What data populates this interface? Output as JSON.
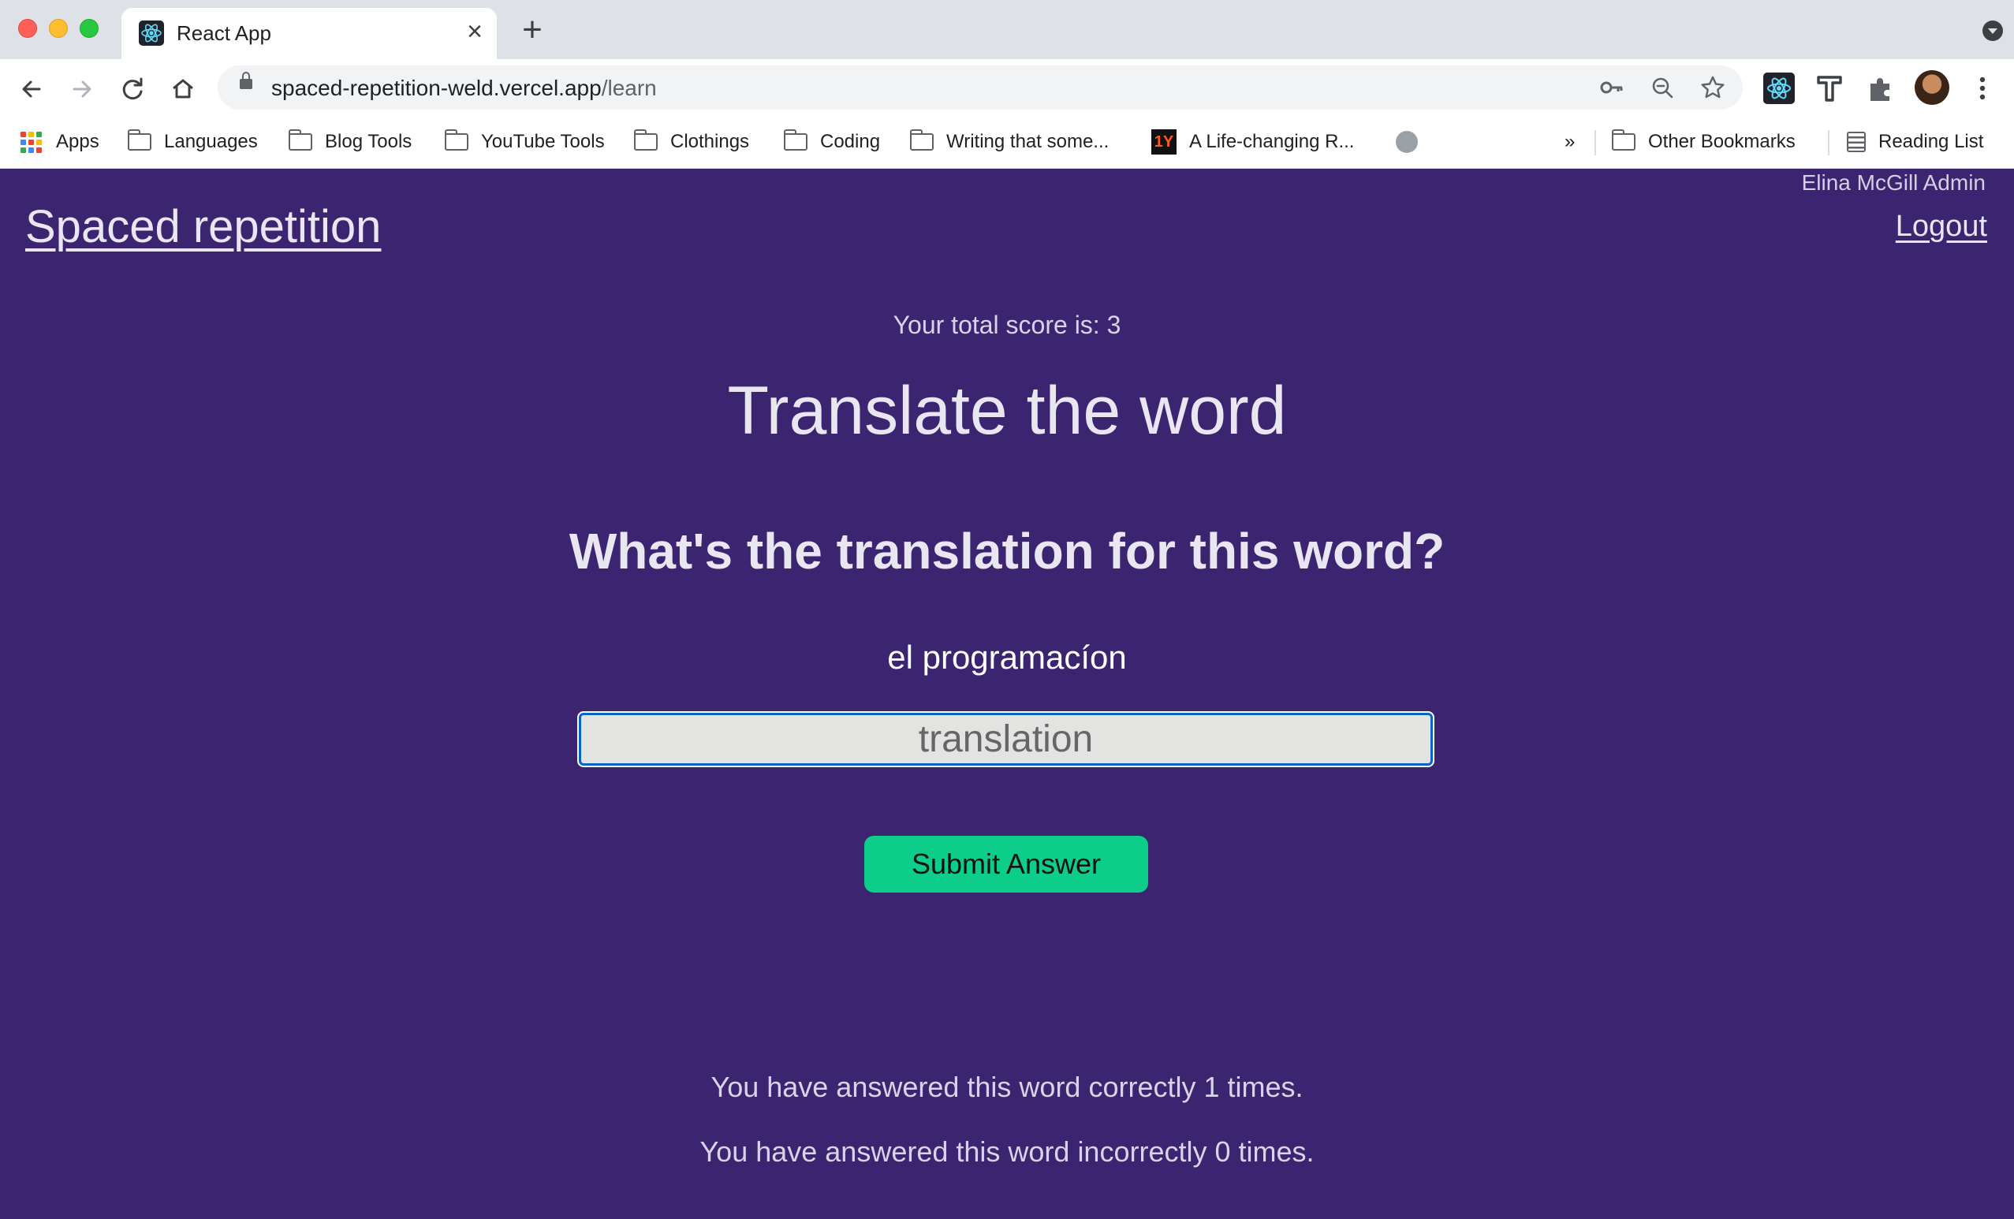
{
  "browser": {
    "tab_title": "React App",
    "url_host": "spaced-repetition-weld.vercel.app",
    "url_path": "/learn",
    "bookmarks": [
      "Apps",
      "Languages",
      "Blog Tools",
      "YouTube Tools",
      "Clothings",
      "Coding",
      "Writing that some...",
      "A Life-changing R..."
    ],
    "overflow_label": "»",
    "other_bookmarks": "Other Bookmarks",
    "reading_list": "Reading List"
  },
  "header": {
    "user_name": "Elina McGill Admin",
    "brand": "Spaced repetition",
    "logout": "Logout"
  },
  "learn": {
    "score_text": "Your total score is: 3",
    "title": "Translate the word",
    "question": "What's the translation for this word?",
    "word": "el programacíon",
    "input_placeholder": "translation",
    "submit_label": "Submit Answer",
    "correct_text": "You have answered this word correctly 1 times.",
    "incorrect_text": "You have answered this word incorrectly 0 times."
  },
  "colors": {
    "page_background": "#3b2571",
    "submit_button": "#0ccd89",
    "input_focus_border": "#0a63c9"
  }
}
